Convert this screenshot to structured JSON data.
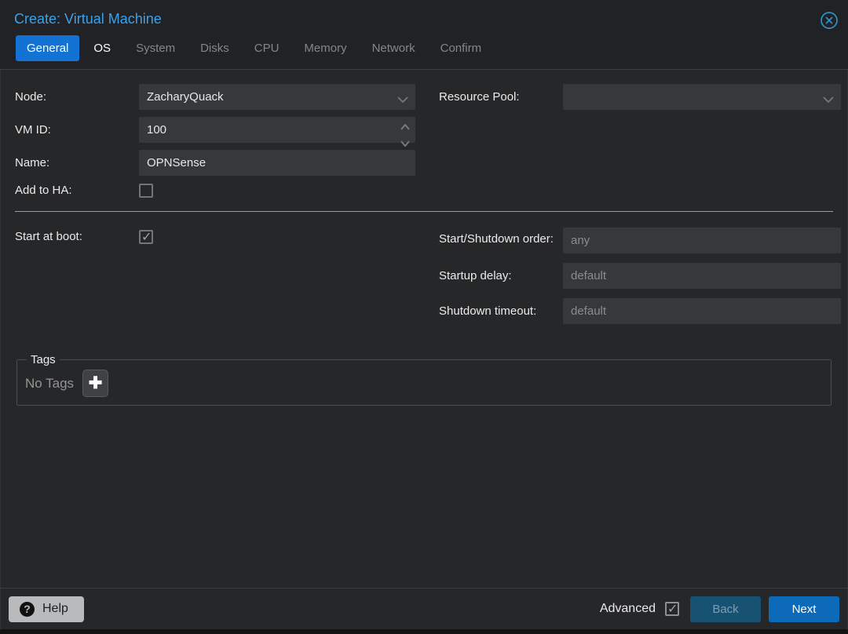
{
  "window": {
    "title": "Create: Virtual Machine",
    "close_icon": "circle-x-icon"
  },
  "tabs": [
    {
      "label": "General",
      "state": "active"
    },
    {
      "label": "OS",
      "state": "enabled"
    },
    {
      "label": "System",
      "state": "disabled"
    },
    {
      "label": "Disks",
      "state": "disabled"
    },
    {
      "label": "CPU",
      "state": "disabled"
    },
    {
      "label": "Memory",
      "state": "disabled"
    },
    {
      "label": "Network",
      "state": "disabled"
    },
    {
      "label": "Confirm",
      "state": "disabled"
    }
  ],
  "form": {
    "node": {
      "label": "Node:",
      "value": "ZacharyQuack",
      "control": "dropdown"
    },
    "vmid": {
      "label": "VM ID:",
      "value": "100",
      "control": "spinner"
    },
    "name": {
      "label": "Name:",
      "value": "OPNSense",
      "control": "text"
    },
    "add_to_ha": {
      "label": "Add to HA:",
      "checked": false
    },
    "resource_pool": {
      "label": "Resource Pool:",
      "value": "",
      "control": "dropdown"
    },
    "start_at_boot": {
      "label": "Start at boot:",
      "checked": true
    },
    "startshutdown_order": {
      "label": "Start/Shutdown order:",
      "placeholder": "any",
      "value": ""
    },
    "startup_delay": {
      "label": "Startup delay:",
      "placeholder": "default",
      "value": ""
    },
    "shutdown_timeout": {
      "label": "Shutdown timeout:",
      "placeholder": "default",
      "value": ""
    },
    "tags": {
      "legend": "Tags",
      "empty_text": "No Tags",
      "add_button_icon": "plus-icon"
    }
  },
  "footer": {
    "help_label": "Help",
    "help_icon": "question-circle-icon",
    "advanced_label": "Advanced",
    "advanced_checked": true,
    "back_label": "Back",
    "next_label": "Next"
  },
  "colors": {
    "accent_blue": "#1273d4",
    "title_blue": "#3da1e8",
    "next_button": "#0c6ab8",
    "back_button": "#175273",
    "body_bg": "#262729",
    "header_bg": "#212225",
    "field_bg": "#37383b"
  }
}
